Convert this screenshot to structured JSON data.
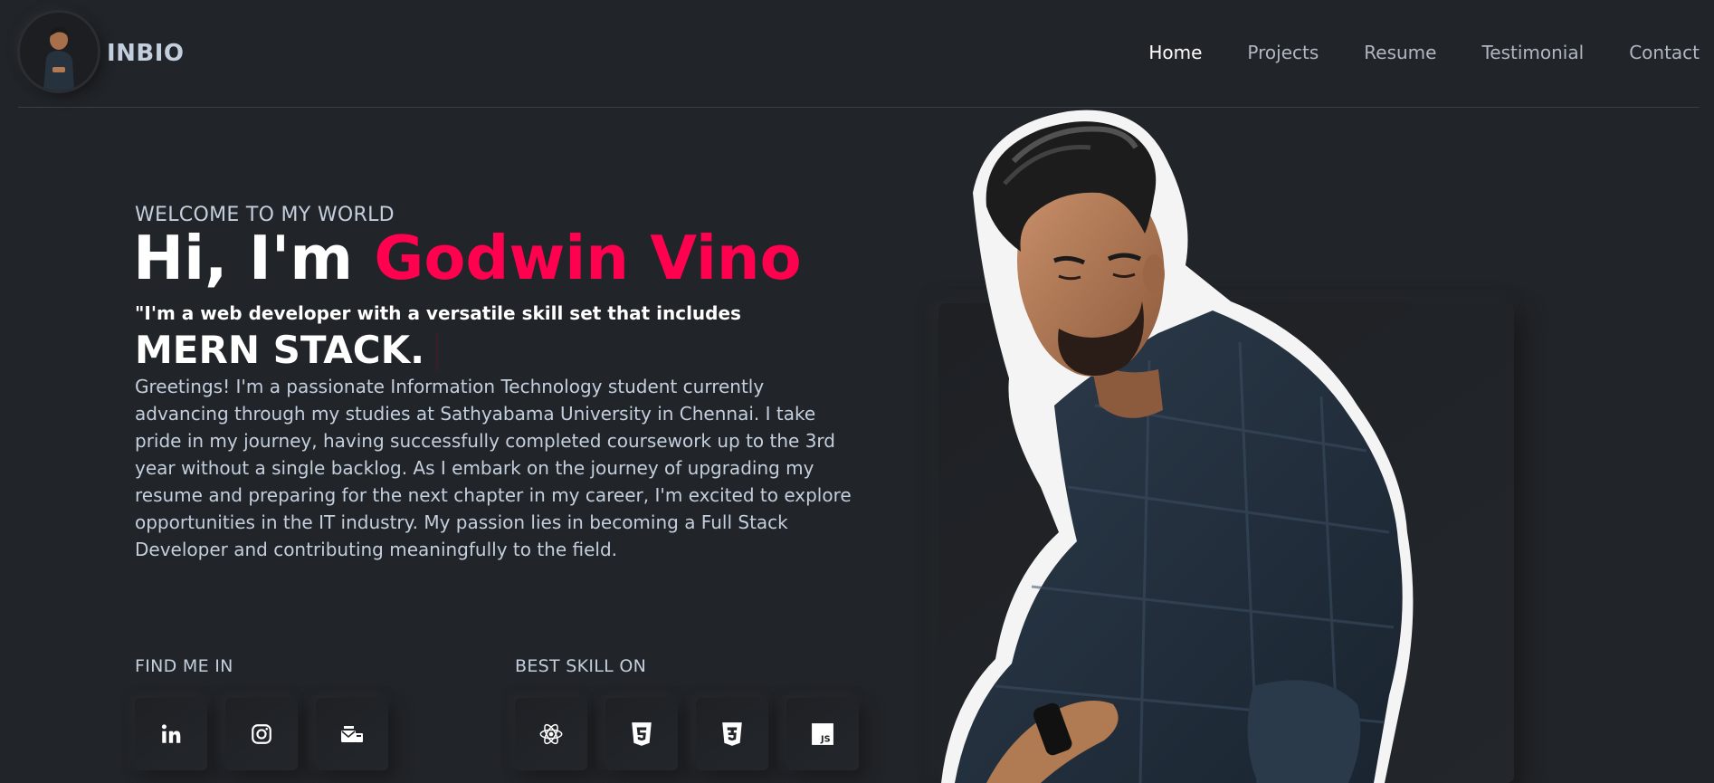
{
  "brand": {
    "name": "INBIO"
  },
  "nav": {
    "items": [
      "Home",
      "Projects",
      "Resume",
      "Testimonial",
      "Contact"
    ],
    "active": "Home"
  },
  "hero": {
    "welcome": "WELCOME TO MY WORLD",
    "greeting": "Hi, I'm ",
    "name": "Godwin Vino",
    "tagline": "\"I'm a web developer with a versatile skill set that includes",
    "typed_text": "MERN STACK.",
    "bio": "Greetings! I'm a passionate Information Technology student currently advancing through my studies at Sathyabama University in Chennai. I take pride in my journey, having successfully completed coursework up to the 3rd year without a single backlog. As I embark on the journey of upgrading my resume and preparing for the next chapter in my career, I'm excited to explore opportunities in the IT industry. My passion lies in becoming a Full Stack Developer and contributing meaningfully to the field."
  },
  "find_me": {
    "label": "FIND ME IN",
    "icons": [
      "linkedin-icon",
      "instagram-icon",
      "contact-mail-icon"
    ]
  },
  "skills": {
    "label": "BEST SKILL ON",
    "icons": [
      "react-icon",
      "html5-icon",
      "css3-icon",
      "javascript-icon"
    ]
  },
  "colors": {
    "background": "#212428",
    "accent": "#ff014f",
    "text": "#c4cfde",
    "heading": "#ffffff"
  }
}
